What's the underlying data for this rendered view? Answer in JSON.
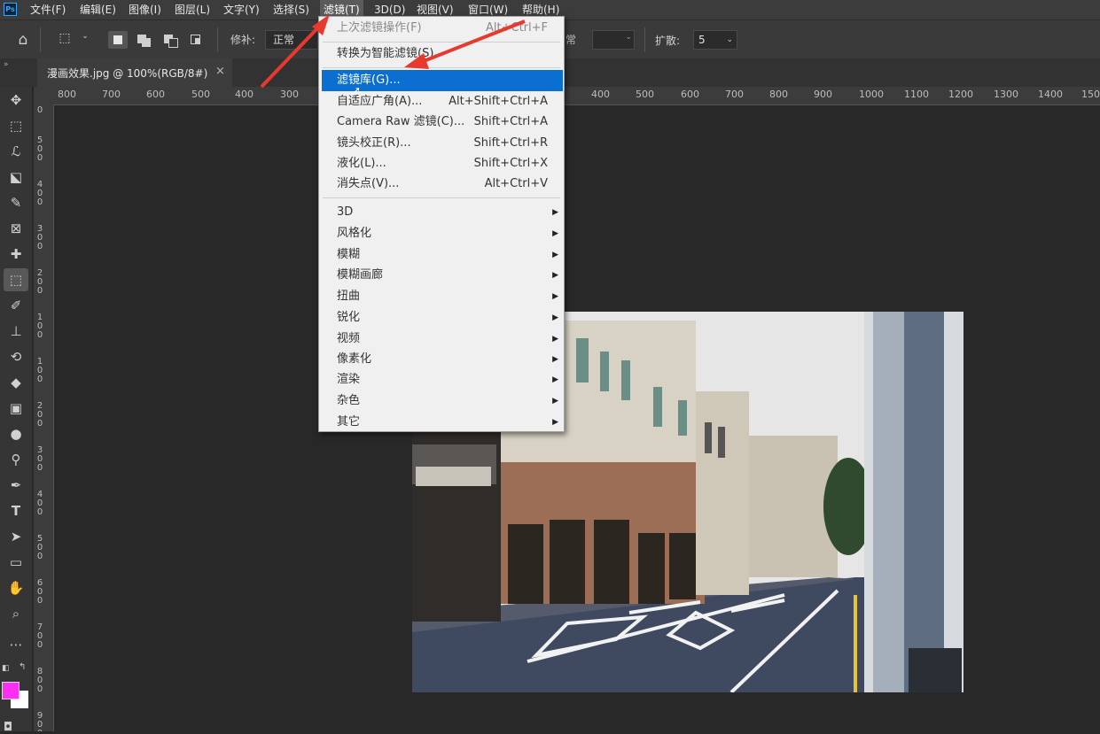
{
  "menubar": {
    "items": [
      "文件(F)",
      "编辑(E)",
      "图像(I)",
      "图层(L)",
      "文字(Y)",
      "选择(S)",
      "滤镜(T)",
      "3D(D)",
      "视图(V)",
      "窗口(W)",
      "帮助(H)"
    ]
  },
  "options": {
    "repair_label": "修补:",
    "repair_value": "正常",
    "spread_label": "扩散:",
    "spread_value": "5",
    "hidden_value": "常"
  },
  "document_tab": {
    "title": "漫画效果.jpg @ 100%(RGB/8#)",
    "close": "×"
  },
  "ruler": {
    "h_left": [
      "800",
      "700",
      "600",
      "500",
      "400",
      "300"
    ],
    "h_right": [
      "400",
      "500",
      "600",
      "700",
      "800",
      "900",
      "1000",
      "1100",
      "1200",
      "1300",
      "1400",
      "150"
    ],
    "v": [
      "0",
      "500",
      "400",
      "300",
      "200",
      "100",
      "0",
      "100",
      "200",
      "300",
      "400",
      "500",
      "600",
      "700",
      "800",
      "900"
    ]
  },
  "filter_menu": {
    "last_filter": {
      "label": "上次滤镜操作(F)",
      "shortcut": "Alt+Ctrl+F"
    },
    "convert_smart": {
      "label": "转换为智能滤镜(S)"
    },
    "gallery": {
      "label": "滤镜库(G)..."
    },
    "adaptive_wide": {
      "label": "自适应广角(A)...",
      "shortcut": "Alt+Shift+Ctrl+A"
    },
    "camera_raw": {
      "label": "Camera Raw 滤镜(C)...",
      "shortcut": "Shift+Ctrl+A"
    },
    "lens_correction": {
      "label": "镜头校正(R)...",
      "shortcut": "Shift+Ctrl+R"
    },
    "liquify": {
      "label": "液化(L)...",
      "shortcut": "Shift+Ctrl+X"
    },
    "vanishing_point": {
      "label": "消失点(V)...",
      "shortcut": "Alt+Ctrl+V"
    },
    "submenus": [
      "3D",
      "风格化",
      "模糊",
      "模糊画廊",
      "扭曲",
      "锐化",
      "视频",
      "像素化",
      "渲染",
      "杂色",
      "其它"
    ]
  },
  "colors": {
    "foreground": "#ff2ef2",
    "background": "#ffffff",
    "highlight": "#0b6fd1",
    "arrow": "#e8392f"
  }
}
